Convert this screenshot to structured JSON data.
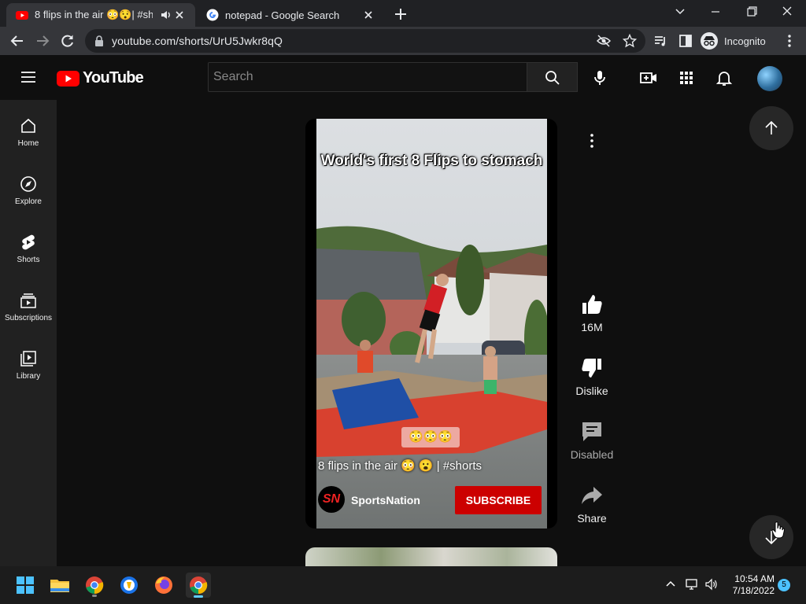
{
  "browser": {
    "tabs": [
      {
        "title": "8 flips in the air 😳😯| #shorts",
        "active": true
      },
      {
        "title": "notepad - Google Search",
        "active": false
      }
    ],
    "url": "youtube.com/shorts/UrU5Jwkr8qQ",
    "profile_label": "Incognito"
  },
  "youtube": {
    "logo_text": "YouTube",
    "search_placeholder": "Search",
    "sidebar": [
      {
        "label": "Home",
        "icon": "home-icon"
      },
      {
        "label": "Explore",
        "icon": "compass-icon"
      },
      {
        "label": "Shorts",
        "icon": "shorts-icon"
      },
      {
        "label": "Subscriptions",
        "icon": "subscriptions-icon"
      },
      {
        "label": "Library",
        "icon": "library-icon"
      }
    ],
    "short": {
      "overlay_caption": "World's first 8 Flips to stomach",
      "emoji_caption": "😳😳😳",
      "title": "8 flips in the air 😳 😮 | #shorts",
      "channel_logo_text": "SN",
      "channel_name": "SportsNation",
      "subscribe_label": "SUBSCRIBE"
    },
    "actions": {
      "like": "16M",
      "dislike": "Dislike",
      "comments": "Disabled",
      "share": "Share"
    },
    "brand_red": "#ff0000",
    "subscribe_color": "#cc0000"
  },
  "taskbar": {
    "apps": [
      "start",
      "file-explorer",
      "chrome",
      "brave",
      "firefox",
      "chrome-active"
    ],
    "time": "10:54 AM",
    "date": "7/18/2022",
    "notification_count": "5"
  }
}
